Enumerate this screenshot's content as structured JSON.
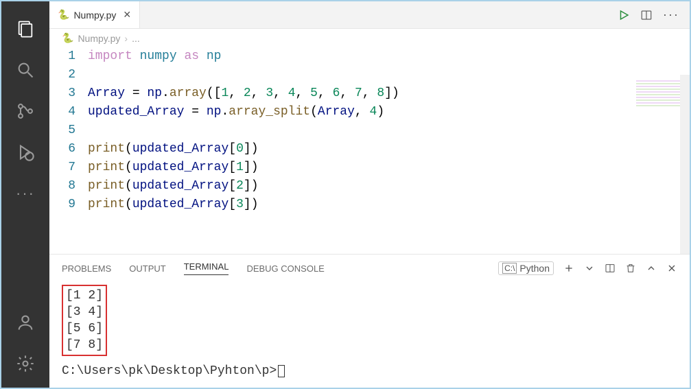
{
  "tab": {
    "filename": "Numpy.py"
  },
  "breadcrumb": {
    "filename": "Numpy.py",
    "more": "..."
  },
  "editor": {
    "lineNumbers": [
      "1",
      "2",
      "3",
      "4",
      "5",
      "6",
      "7",
      "8",
      "9"
    ]
  },
  "code": {
    "l1": {
      "import": "import",
      "numpy": "numpy",
      "as": "as",
      "np": "np"
    },
    "l3_var": "Array",
    "l3_eq": " = ",
    "l3_np": "np",
    "l3_dot": ".",
    "l3_fn": "array",
    "l3_open": "([",
    "l3_nums": [
      "1",
      "2",
      "3",
      "4",
      "5",
      "6",
      "7",
      "8"
    ],
    "l3_close": "])",
    "l4_var": "updated_Array",
    "l4_eq": " = ",
    "l4_np": "np",
    "l4_dot": ".",
    "l4_fn": "array_split",
    "l4_open": "(",
    "l4_arg1": "Array",
    "l4_comma": ", ",
    "l4_arg2": "4",
    "l4_close": ")",
    "print": "print",
    "uarr": "updated_Array",
    "idx": [
      "0",
      "1",
      "2",
      "3"
    ]
  },
  "panel": {
    "tabs": {
      "problems": "PROBLEMS",
      "output": "OUTPUT",
      "terminal": "TERMINAL",
      "debug": "DEBUG CONSOLE"
    },
    "lang": "Python"
  },
  "terminal": {
    "output": [
      "[1 2]",
      "[3 4]",
      "[5 6]",
      "[7 8]"
    ],
    "prompt": "C:\\Users\\pk\\Desktop\\Pyhton\\p>"
  }
}
